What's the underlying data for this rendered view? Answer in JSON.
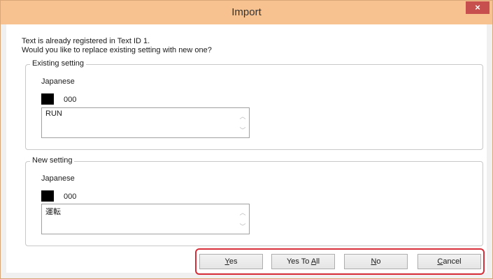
{
  "window": {
    "title": "Import",
    "close_glyph": "×"
  },
  "message": {
    "line1": "Text is already registered in Text ID 1.",
    "line2": "Would you like to replace existing setting with new one?"
  },
  "existing": {
    "group_label": "Existing setting",
    "language": "Japanese",
    "color": "#000000",
    "code": "000",
    "text": "RUN"
  },
  "new": {
    "group_label": "New setting",
    "language": "Japanese",
    "color": "#000000",
    "code": "000",
    "text": "運転"
  },
  "buttons": {
    "yes": {
      "mnemonic": "Y",
      "rest": "es"
    },
    "yes_to_all": {
      "prefix": "Yes To ",
      "mnemonic": "A",
      "rest": "ll"
    },
    "no": {
      "mnemonic": "N",
      "rest": "o"
    },
    "cancel": {
      "mnemonic": "C",
      "rest": "ancel"
    }
  },
  "colors": {
    "titlebar": "#f7c28f",
    "close": "#c7504f",
    "highlight": "#d72e3a"
  }
}
